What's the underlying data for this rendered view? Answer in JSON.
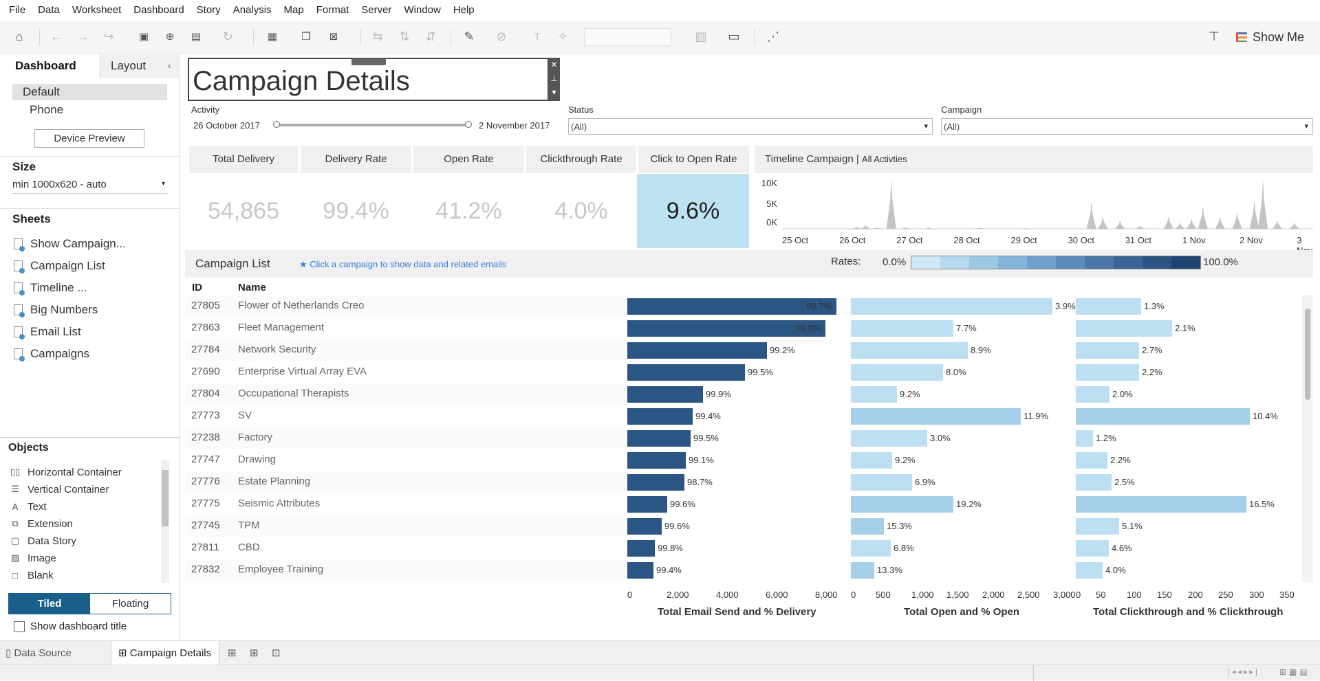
{
  "menu": [
    "File",
    "Data",
    "Worksheet",
    "Dashboard",
    "Story",
    "Analysis",
    "Map",
    "Format",
    "Server",
    "Window",
    "Help"
  ],
  "toolbar": {
    "show_me": "Show Me"
  },
  "left_pane": {
    "tabs": [
      "Dashboard",
      "Layout"
    ],
    "device": {
      "default": "Default",
      "phone": "Phone",
      "preview_button": "Device Preview"
    },
    "size": {
      "title": "Size",
      "value": "min 1000x620 - auto"
    },
    "sheets": {
      "title": "Sheets",
      "items": [
        "Show Campaign...",
        "Campaign List",
        "Timeline ...",
        "Big Numbers",
        "Email List",
        "Campaigns"
      ]
    },
    "objects": {
      "title": "Objects",
      "items": [
        {
          "label": "Horizontal Container",
          "icon": "horizontal-container-icon"
        },
        {
          "label": "Vertical Container",
          "icon": "vertical-container-icon"
        },
        {
          "label": "Text",
          "icon": "text-icon"
        },
        {
          "label": "Extension",
          "icon": "extension-icon"
        },
        {
          "label": "Data Story",
          "icon": "data-story-icon"
        },
        {
          "label": "Image",
          "icon": "image-icon"
        },
        {
          "label": "Blank",
          "icon": "blank-icon"
        }
      ]
    },
    "layout_mode": {
      "tiled": "Tiled",
      "floating": "Floating"
    },
    "show_title": "Show dashboard title"
  },
  "bottom_tabs": {
    "data_source": "Data Source",
    "active_sheet": "Campaign Details"
  },
  "dashboard": {
    "title": "Campaign Details",
    "filters": {
      "activity": {
        "label": "Activity",
        "start": "26 October 2017",
        "end": "2 November 2017"
      },
      "status": {
        "label": "Status",
        "value": "(All)"
      },
      "campaign": {
        "label": "Campaign",
        "value": "(All)"
      }
    },
    "kpis": [
      {
        "label": "Total Delivery",
        "value": "54,865"
      },
      {
        "label": "Delivery Rate",
        "value": "99.4%"
      },
      {
        "label": "Open Rate",
        "value": "41.2%"
      },
      {
        "label": "Clickthrough Rate",
        "value": "4.0%"
      },
      {
        "label": "Click to Open Rate",
        "value": "9.6%"
      }
    ],
    "timeline": {
      "title": "Timeline Campaign |",
      "subtitle": "All Activties",
      "y_ticks": [
        "10K",
        "5K",
        "0K"
      ],
      "x_ticks": [
        "25 Oct",
        "26 Oct",
        "27 Oct",
        "28 Oct",
        "29 Oct",
        "30 Oct",
        "31 Oct",
        "1 Nov",
        "2 Nov",
        "3 Nov"
      ]
    },
    "list": {
      "title": "Campaign List",
      "hint": "★ Click a campaign to show data and related emails",
      "rates_label": "Rates:",
      "rates_min": "0.0%",
      "rates_max": "100.0%",
      "columns": {
        "id": "ID",
        "name": "Name"
      }
    },
    "axes": {
      "send": {
        "title": "Total Email Send and % Delivery",
        "ticks": [
          "0",
          "2,000",
          "4,000",
          "6,000",
          "8,000"
        ]
      },
      "open": {
        "title": "Total Open and % Open",
        "ticks": [
          "0",
          "500",
          "1,000",
          "1,500",
          "2,000",
          "2,500",
          "3,000"
        ]
      },
      "click": {
        "title": "Total Clickthrough and % Clickthrough",
        "ticks": [
          "0",
          "50",
          "100",
          "150",
          "200",
          "250",
          "300",
          "350"
        ]
      }
    }
  },
  "chart_data": {
    "type": "bar",
    "categories": [
      "27805",
      "27863",
      "27784",
      "27690",
      "27804",
      "27773",
      "27238",
      "27747",
      "27776",
      "27775",
      "27745",
      "27811",
      "27832"
    ],
    "names": [
      "Flower of Netherlands Creo",
      "Fleet Management",
      "Network Security",
      "Enterprise Virtual Array EVA",
      "Occupational Therapists",
      "SV",
      "Factory",
      "Drawing",
      "Estate Planning",
      "Seismic Attributes",
      "TPM",
      "CBD",
      "Employee Training"
    ],
    "series": [
      {
        "name": "Total Email Send",
        "values": [
          8450,
          8000,
          5650,
          4750,
          3050,
          2650,
          2550,
          2350,
          2300,
          1600,
          1400,
          1100,
          1050
        ]
      },
      {
        "name": "% Delivery",
        "values": [
          "99.7%",
          "99.3%",
          "99.2%",
          "99.5%",
          "99.9%",
          "99.4%",
          "99.5%",
          "99.1%",
          "98.7%",
          "99.6%",
          "99.6%",
          "99.8%",
          "99.4%"
        ]
      },
      {
        "name": "Total Open",
        "values": [
          2850,
          1450,
          1650,
          1300,
          650,
          2400,
          1080,
          580,
          870,
          1450,
          470,
          560,
          330
        ]
      },
      {
        "name": "% Open",
        "values": [
          "3.9%",
          "7.7%",
          "8.9%",
          "8.0%",
          "9.2%",
          "11.9%",
          "3.0%",
          "9.2%",
          "6.9%",
          "19.2%",
          "15.3%",
          "6.8%",
          "13.3%"
        ]
      },
      {
        "name": "Total Clickthrough",
        "values": [
          107,
          158,
          104,
          104,
          55,
          285,
          28,
          52,
          58,
          279,
          71,
          54,
          44
        ]
      },
      {
        "name": "% Clickthrough",
        "values": [
          "1.3%",
          "2.1%",
          "2.7%",
          "2.2%",
          "2.0%",
          "10.4%",
          "1.2%",
          "2.2%",
          "2.5%",
          "16.5%",
          "5.1%",
          "4.6%",
          "4.0%"
        ]
      }
    ],
    "xlim_send": [
      0,
      9000
    ],
    "xlim_open": [
      0,
      3150
    ],
    "xlim_click": [
      0,
      360
    ],
    "colors": {
      "send": "#2b5582",
      "open_light": "#bcdff2",
      "open_mid": "#a6cfea",
      "click_to_open_bg": "#bde3f2",
      "hint": "#3a7ad9"
    },
    "timeline_series": {
      "x": [
        "25 Oct",
        "26 Oct",
        "27 Oct",
        "28 Oct",
        "29 Oct",
        "30 Oct",
        "31 Oct",
        "1 Nov",
        "2 Nov",
        "3 Nov"
      ],
      "peaks": [
        [
          1.25,
          500
        ],
        [
          1.4,
          900
        ],
        [
          1.6,
          300
        ],
        [
          1.85,
          12000
        ],
        [
          2.1,
          400
        ],
        [
          2.5,
          300
        ],
        [
          3.4,
          300
        ],
        [
          4.2,
          200
        ],
        [
          5.35,
          6500
        ],
        [
          5.55,
          3000
        ],
        [
          5.85,
          2000
        ],
        [
          6.2,
          800
        ],
        [
          6.7,
          3000
        ],
        [
          6.9,
          1500
        ],
        [
          7.1,
          2500
        ],
        [
          7.3,
          5500
        ],
        [
          7.6,
          3000
        ],
        [
          7.9,
          4000
        ],
        [
          8.2,
          7000
        ],
        [
          8.35,
          12000
        ],
        [
          8.6,
          2000
        ],
        [
          8.9,
          1500
        ]
      ],
      "ymax": 12500
    }
  }
}
